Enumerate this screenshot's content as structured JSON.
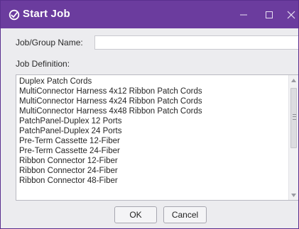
{
  "window": {
    "title": "Start Job",
    "controls": {
      "minimize_icon": "minimize-icon",
      "maximize_icon": "maximize-icon",
      "close_icon": "close-icon"
    }
  },
  "form": {
    "job_group_name_label": "Job/Group Name:",
    "job_group_name_value": "",
    "job_definition_label": "Job Definition:"
  },
  "job_definitions": [
    "Duplex Patch Cords",
    "MultiConnector Harness 4x12 Ribbon Patch Cords",
    "MultiConnector Harness 4x24 Ribbon Patch Cords",
    "MultiConnector Harness 4x48 Ribbon Patch Cords",
    "PatchPanel-Duplex 12 Ports",
    "PatchPanel-Duplex 24 Ports",
    "Pre-Term Cassette 12-Fiber",
    "Pre-Term Cassette 24-Fiber",
    "Ribbon Connector 12-Fiber",
    "Ribbon Connector 24-Fiber",
    "Ribbon Connector 48-Fiber"
  ],
  "buttons": {
    "ok": "OK",
    "cancel": "Cancel"
  },
  "colors": {
    "titlebar": "#6b3c9e",
    "window_background": "#ececef"
  }
}
